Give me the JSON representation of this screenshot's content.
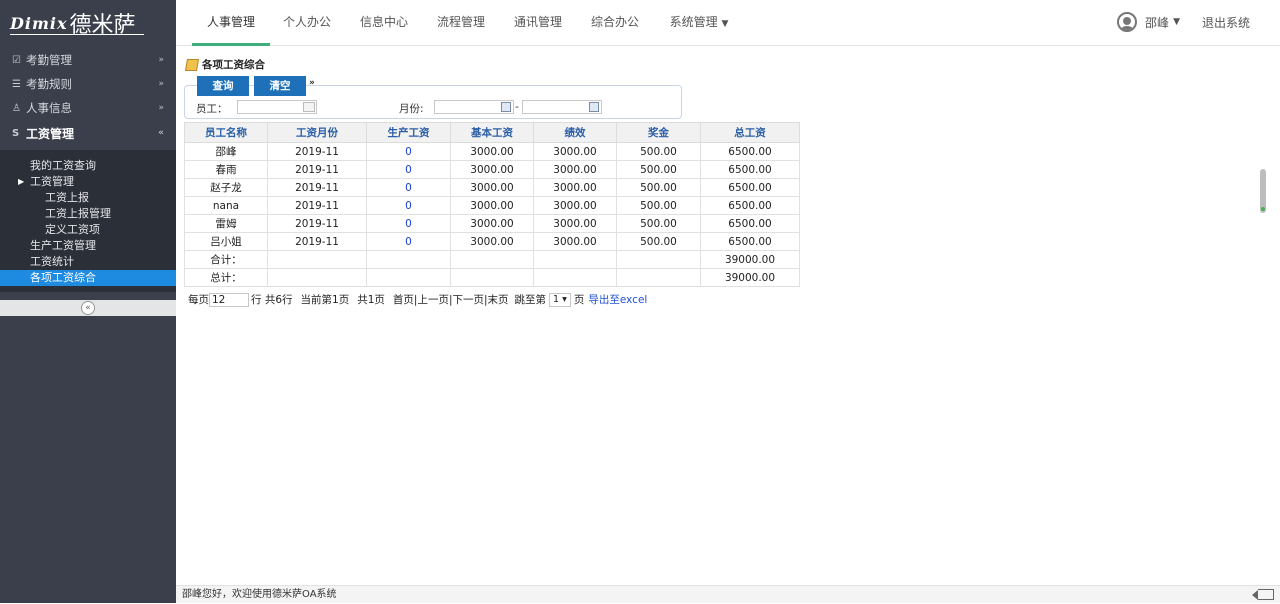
{
  "brand": {
    "en": "Dimix",
    "cn": "德米萨"
  },
  "sidebar": {
    "groups": [
      {
        "label": "考勤管理",
        "icon": "checkbox-icon"
      },
      {
        "label": "考勤规则",
        "icon": "list-icon"
      },
      {
        "label": "人事信息",
        "icon": "person-icon"
      },
      {
        "label": "工资管理",
        "icon": "money-icon"
      }
    ],
    "sub_items": [
      "我的工资查询",
      "工资管理",
      "工资上报",
      "工资上报管理",
      "定义工资项",
      "生产工资管理",
      "工资统计",
      "各项工资综合"
    ],
    "collapse_symbol": "«"
  },
  "topnav": {
    "items": [
      "人事管理",
      "个人办公",
      "信息中心",
      "流程管理",
      "通讯管理",
      "综合办公",
      "系统管理"
    ],
    "active": "人事管理",
    "user_name": "邵峰",
    "logout": "退出系统"
  },
  "page": {
    "title": "各项工资综合",
    "query_button": "查询",
    "clear_button": "清空",
    "employee_label": "员工：",
    "month_label": "月份:",
    "month_separator": "-"
  },
  "table": {
    "headers": [
      "员工名称",
      "工资月份",
      "生产工资",
      "基本工资",
      "绩效",
      "奖金",
      "总工资"
    ],
    "rows": [
      [
        "邵峰",
        "2019-11",
        "0",
        "3000.00",
        "3000.00",
        "500.00",
        "6500.00"
      ],
      [
        "春雨",
        "2019-11",
        "0",
        "3000.00",
        "3000.00",
        "500.00",
        "6500.00"
      ],
      [
        "赵子龙",
        "2019-11",
        "0",
        "3000.00",
        "3000.00",
        "500.00",
        "6500.00"
      ],
      [
        "nana",
        "2019-11",
        "0",
        "3000.00",
        "3000.00",
        "500.00",
        "6500.00"
      ],
      [
        "雷姆",
        "2019-11",
        "0",
        "3000.00",
        "3000.00",
        "500.00",
        "6500.00"
      ],
      [
        "吕小姐",
        "2019-11",
        "0",
        "3000.00",
        "3000.00",
        "500.00",
        "6500.00"
      ]
    ],
    "subtotal_label": "合计：",
    "subtotal_value": "39000.00",
    "total_label": "总计：",
    "total_value": "39000.00"
  },
  "pager": {
    "per_page_label": "每页",
    "per_page_value": "12",
    "rows_text": "行 共6行",
    "current_page_text": "当前第1页",
    "total_pages_text": "共1页",
    "nav_text": "首页|上一页|下一页|末页",
    "jump_label": "跳至第",
    "jump_value": "1 ▾",
    "page_suffix": "页",
    "export_label": "导出至excel"
  },
  "footer": {
    "welcome": "邵峰您好，欢迎使用德米萨OA系统"
  },
  "colors": {
    "accent": "#1e70b8",
    "sidebar_bg": "#3a3f4b",
    "selected": "#1e8ae0",
    "active_tab": "#3fae7d"
  }
}
